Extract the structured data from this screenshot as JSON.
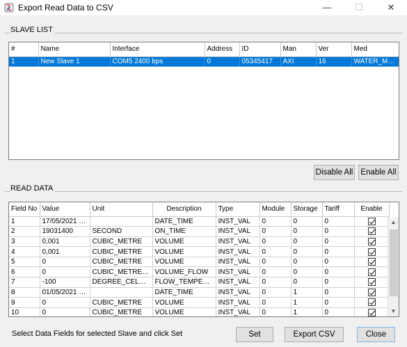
{
  "window": {
    "title": "Export Read Data to CSV",
    "minimize_glyph": "—",
    "maximize_glyph": "☐",
    "close_glyph": "✕"
  },
  "slave_list": {
    "label": "SLAVE LIST",
    "columns": [
      "#",
      "Name",
      "Interface",
      "Address",
      "ID",
      "Man",
      "Ver",
      "Med"
    ],
    "rows": [
      [
        "1",
        "New Slave 1",
        "COM5 2400 bps",
        "0",
        "05345417",
        "AXI",
        "16",
        "WATER_MET..."
      ]
    ]
  },
  "buttons": {
    "disable_all": "Disable All",
    "enable_all": "Enable All",
    "set": "Set",
    "export_csv": "Export CSV",
    "close": "Close"
  },
  "read_data": {
    "label": "READ DATA",
    "columns": [
      "Field No",
      "Value",
      "Unit",
      "Description",
      "Type",
      "Module",
      "Storage",
      "Tariff",
      "Enable"
    ],
    "rows": [
      [
        "1",
        "17/05/2021 1...",
        "",
        "DATE_TIME",
        "INST_VAL",
        "0",
        "0",
        "0",
        true
      ],
      [
        "2",
        "19031400",
        "SECOND",
        "ON_TIME",
        "INST_VAL",
        "0",
        "0",
        "0",
        true
      ],
      [
        "3",
        "0,001",
        "CUBIC_METRE",
        "VOLUME",
        "INST_VAL",
        "0",
        "0",
        "0",
        true
      ],
      [
        "4",
        "0,001",
        "CUBIC_METRE",
        "VOLUME",
        "INST_VAL",
        "0",
        "0",
        "0",
        true
      ],
      [
        "5",
        "0",
        "CUBIC_METRE",
        "VOLUME",
        "INST_VAL",
        "0",
        "0",
        "0",
        true
      ],
      [
        "6",
        "0",
        "CUBIC_METRE_P...",
        "VOLUME_FLOW",
        "INST_VAL",
        "0",
        "0",
        "0",
        true
      ],
      [
        "7",
        "-100",
        "DEGREE_CELSIUS",
        "FLOW_TEMPERA...",
        "INST_VAL",
        "0",
        "0",
        "0",
        true
      ],
      [
        "8",
        "01/05/2021 0...",
        "",
        "DATE_TIME",
        "INST_VAL",
        "0",
        "1",
        "0",
        true
      ],
      [
        "9",
        "0",
        "CUBIC_METRE",
        "VOLUME",
        "INST_VAL",
        "0",
        "1",
        "0",
        true
      ],
      [
        "10",
        "0",
        "CUBIC_METRE",
        "VOLUME",
        "INST_VAL",
        "0",
        "1",
        "0",
        true
      ]
    ]
  },
  "status_text": "Select Data Fields for selected Slave and click Set"
}
